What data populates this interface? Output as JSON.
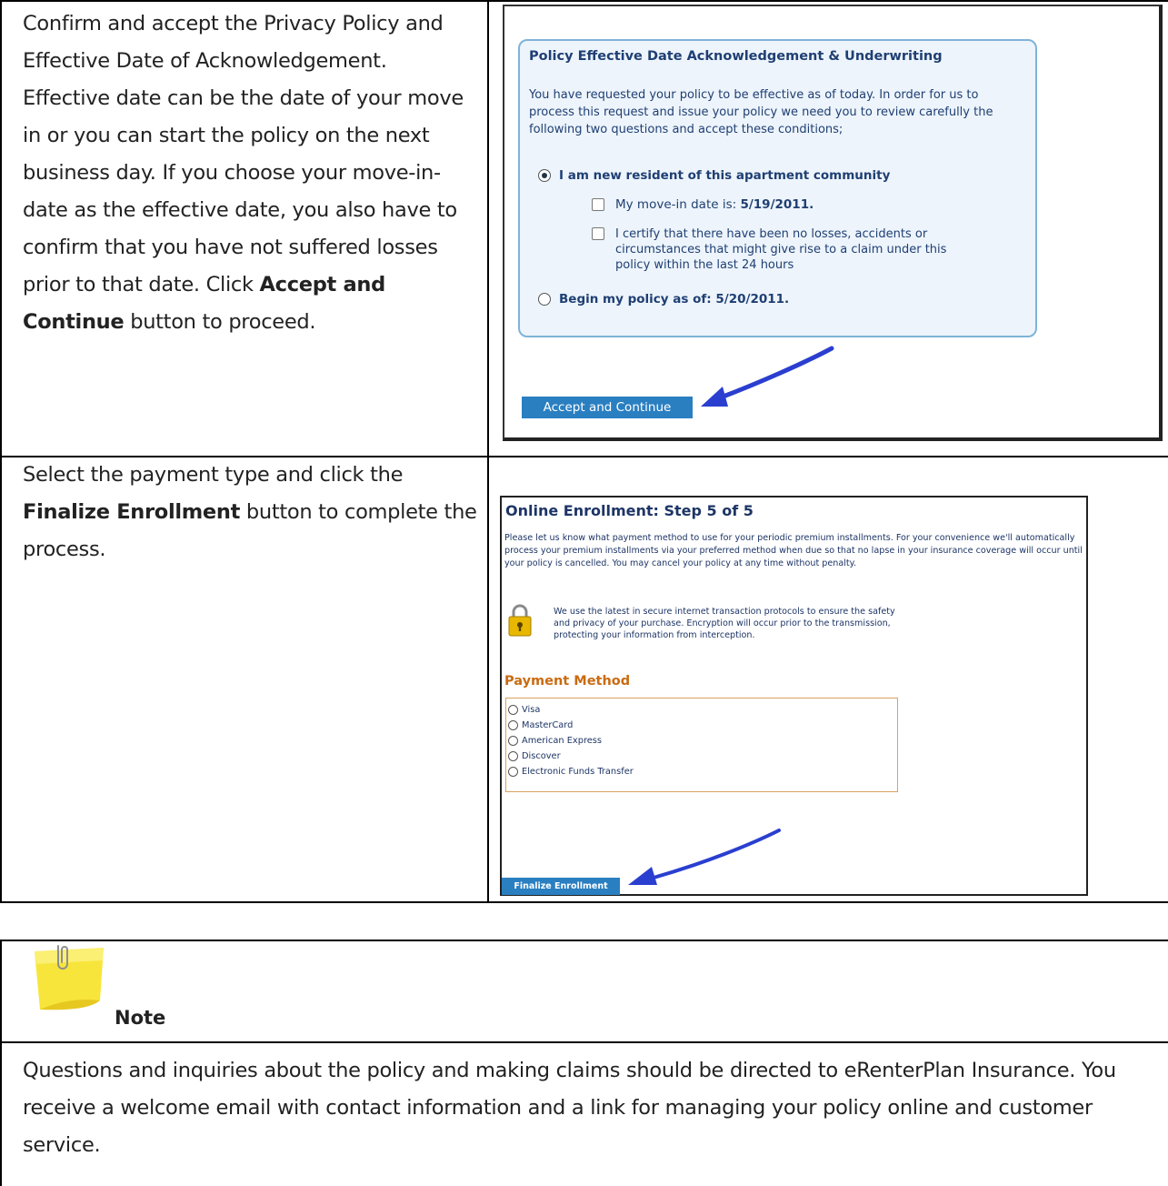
{
  "step1": {
    "instructions_parts": [
      "Confirm and accept the Privacy Policy and Effective Date of Acknowledgement. Effective date can be the date of your move in or you can start the policy on the next business day.  If you choose your move-in-date as the effective date, you also have to confirm that you have not suffered losses prior to that date. Click ",
      "Accept and Continue",
      " button to proceed."
    ],
    "screenshot": {
      "panel_title": "Policy Effective Date Acknowledgement & Underwriting",
      "intro": "You have requested your policy to be effective as of today. In order for us to process this request and issue your policy we need you to review carefully the following two questions and accept these conditions;",
      "option_new_resident": "I am new resident of this apartment community",
      "check_move_in_prefix": "My move-in date is: ",
      "check_move_in_date": "5/19/2011.",
      "check_certify": "I certify that there have been no losses, accidents or circumstances that might give rise to a claim under this policy within the last 24 hours",
      "option_begin_prefix": "Begin my policy as of: ",
      "option_begin_date": "5/20/2011.",
      "accept_button": "Accept and Continue"
    }
  },
  "step2": {
    "instructions_parts": [
      "Select the payment type and click the ",
      "Finalize Enrollment",
      " button to complete the process."
    ],
    "screenshot": {
      "title": "Online Enrollment: Step 5 of 5",
      "intro": "Please let us know what payment method to use for your periodic premium installments.  For your convenience we'll automatically process your premium installments via your preferred method when due so that no lapse in your insurance coverage will occur until your policy is cancelled.  You may cancel your policy at any time without penalty.",
      "secure_text": "We use the latest in secure internet transaction protocols to ensure the safety and privacy of your purchase.  Encryption will occur prior to the transmission, protecting your information from interception.",
      "payment_heading": "Payment Method",
      "payment_options": [
        "Visa",
        "MasterCard",
        "American Express",
        "Discover",
        "Electronic Funds Transfer"
      ],
      "finalize_button": "Finalize Enrollment"
    }
  },
  "note": {
    "label": "Note",
    "body": "Questions and inquiries about the policy and making claims should be directed to eRenterPlan Insurance.  You receive a welcome email with contact information and a link for managing your policy online and customer service."
  },
  "colors": {
    "panel_border": "#7fb3d8",
    "panel_bg": "#edf4fb",
    "button_blue": "#2a7fc1",
    "heading_orange": "#c96b12",
    "arrow_blue": "#2a3fd0",
    "sticky_yellow": "#f7e53b"
  },
  "icons": [
    "lock-icon",
    "arrow-icon",
    "sticky-note-icon",
    "paperclip-icon"
  ]
}
